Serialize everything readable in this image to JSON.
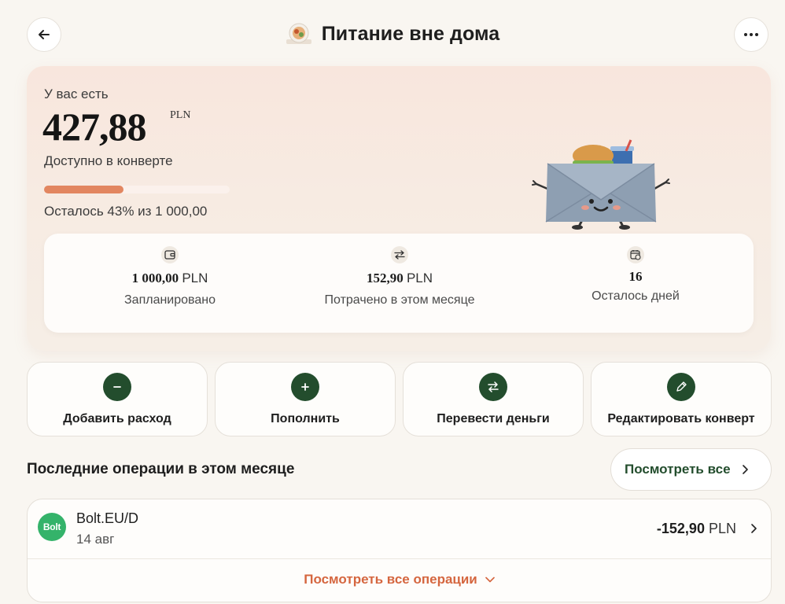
{
  "header": {
    "title": "Питание вне дома",
    "icons": {
      "back": "arrow-left-icon",
      "more": "more-horizontal-icon",
      "title": "food-plate-icon"
    }
  },
  "balance": {
    "label": "У вас есть",
    "amount": "427,88",
    "currency": "PLN",
    "available_label": "Доступно в конверте",
    "progress_fraction": 0.43,
    "remaining_text": "Осталось 43% из 1 000,00"
  },
  "stats": [
    {
      "value": "1 000,00",
      "currency": "PLN",
      "label": "Запланировано",
      "icon": "wallet-icon"
    },
    {
      "value": "152,90",
      "currency": "PLN",
      "label": "Потрачено в этом месяце",
      "icon": "transfer-arrows-icon"
    },
    {
      "value": "16",
      "currency": "",
      "label": "Осталось дней",
      "icon": "calendar-clock-icon"
    }
  ],
  "actions": [
    {
      "label": "Добавить расход",
      "icon": "minus-icon"
    },
    {
      "label": "Пополнить",
      "icon": "plus-icon"
    },
    {
      "label": "Перевести деньги",
      "icon": "transfer-arrows-icon"
    },
    {
      "label": "Редактировать конверт",
      "icon": "pencil-icon"
    }
  ],
  "recent": {
    "title": "Последние операции в этом месяце",
    "see_all": "Посмотреть все",
    "transactions": [
      {
        "logo": "Bolt",
        "name": "Bolt.EU/D",
        "date": "14 авг",
        "amount": "-152,90",
        "currency": "PLN"
      }
    ],
    "see_all_ops": "Посмотреть все операции"
  },
  "colors": {
    "accent_green": "#234d2d",
    "accent_orange": "#d5663f",
    "progress": "#e28660",
    "bolt_green": "#34b36a"
  }
}
